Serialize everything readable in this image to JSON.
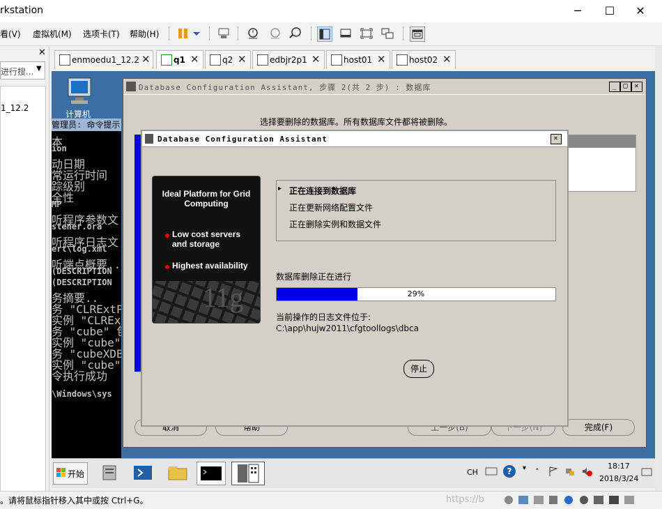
{
  "host": {
    "title": "rkstation",
    "controls": {
      "minimize": "─",
      "maximize": "☐",
      "close": "✕"
    },
    "menu": [
      "看(V)",
      "虚拟机(M)",
      "选项卡(T)",
      "帮助(H)"
    ],
    "library_search_placeholder": "进行搜...",
    "library_close": "✕",
    "library_item": "1_12.2"
  },
  "tabs": [
    {
      "label": "enmoedu1_12.2",
      "close": "✕",
      "active": false
    },
    {
      "label": "q1",
      "close": "✕",
      "active": true
    },
    {
      "label": "q2",
      "close": "✕",
      "active": false
    },
    {
      "label": "edbjr2p1",
      "close": "✕",
      "active": false
    },
    {
      "label": "host01",
      "close": "✕",
      "active": false
    },
    {
      "label": "host02",
      "close": "✕",
      "active": false
    }
  ],
  "desktop": {
    "computer_icon_label": "计算机"
  },
  "console": {
    "title": "管理员: 命令提示",
    "lines": [
      "本",
      "ion",
      "动日期",
      "常运行时间",
      "踪级别",
      "全性",
      "MP",
      "听程序参数文",
      "stener.ora",
      "听程序日志文",
      "ert\\log.xml",
      "听端点概要..",
      "(DESCRIPTION",
      "(DESCRIPTION",
      "务摘要..",
      "务 \"CLRExtPro",
      "实例 \"CLRExt",
      "务 \"cube\" 包",
      "实例 \"cube\",",
      "务 \"cubeXDB\"",
      "实例 \"cube\",",
      "令执行成功",
      "",
      "\\Windows\\sys"
    ]
  },
  "dbca_main": {
    "title": "Database Configuration Assistant, 步骤 2(共 2 步) : 数据库",
    "instruction": "选择要删除的数据库。所有数据库文件都将被删除。",
    "buttons": {
      "cancel": "取消",
      "help": "帮助",
      "back": "上一步(B)",
      "next": "下一步(N)",
      "finish": "完成(F)"
    }
  },
  "dbca_progress": {
    "title": "Database Configuration Assistant",
    "close": "✕",
    "banner": {
      "headline": "Ideal Platform for Grid Computing",
      "bullet1": "Low cost servers and storage",
      "bullet2": "Highest availability",
      "version": "11g"
    },
    "steps": [
      "正在连接到数据库",
      "正在更新网络配置文件",
      "正在删除实例和数据文件"
    ],
    "progress_label": "数据库删除正在进行",
    "progress_fraction": 0.29,
    "progress_text": "29%",
    "log_label": "当前操作的日志文件位于:",
    "log_path": "C:\\app\\hujw2011\\cfgtoollogs\\dbca",
    "stop_button": "停止"
  },
  "taskbar": {
    "start_label": "开始",
    "lang": "CH",
    "time": "18:17",
    "date": "2018/3/24"
  },
  "status": {
    "hint": "。请将鼠标指针移入其中或按 Ctrl+G。",
    "watermark": "https://b"
  },
  "colors": {
    "progress_fill": "#0000e6",
    "console_bg": "#000000",
    "desktop_bg": "#3a6ea5",
    "tb_pause": "#e69c24"
  }
}
